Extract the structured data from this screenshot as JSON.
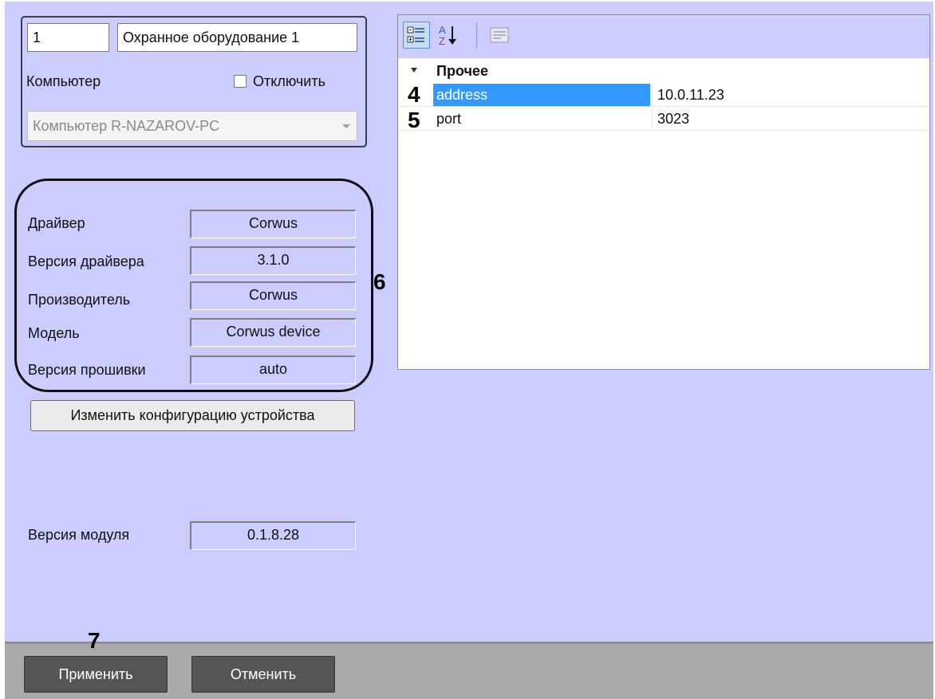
{
  "object": {
    "id": "1",
    "name": "Охранное оборудование 1",
    "computer_label": "Компьютер",
    "disable_label": "Отключить",
    "disable_checked": false,
    "computer_value": "Компьютер R-NAZAROV-PC"
  },
  "driver_info": {
    "rows": [
      {
        "label": "Драйвер",
        "value": "Corwus"
      },
      {
        "label": "Версия драйвера",
        "value": "3.1.0"
      },
      {
        "label": "Производитель",
        "value": "Corwus"
      },
      {
        "label": "Модель",
        "value": "Corwus device"
      },
      {
        "label": "Версия прошивки",
        "value": "auto"
      }
    ],
    "callout": "6"
  },
  "change_config_button": "Изменить конфигурацию устройства",
  "module_version": {
    "label": "Версия модуля",
    "value": "0.1.8.28"
  },
  "property_grid": {
    "toolbar": {
      "categorized_icon": "categorized-icon",
      "alphabetical_icon": "sort-az-icon",
      "property_pages_icon": "property-pages-icon"
    },
    "category": "Прочее",
    "rows": [
      {
        "marker": "4",
        "name": "address",
        "value": "10.0.11.23",
        "selected": true
      },
      {
        "marker": "5",
        "name": "port",
        "value": "3023",
        "selected": false
      }
    ]
  },
  "footer": {
    "apply_label": "Применить",
    "cancel_label": "Отменить",
    "callout": "7"
  },
  "colors": {
    "panel": "#ccccff",
    "footer": "#aaaaaa",
    "selection": "#3399ff",
    "dark_button": "#555555"
  }
}
